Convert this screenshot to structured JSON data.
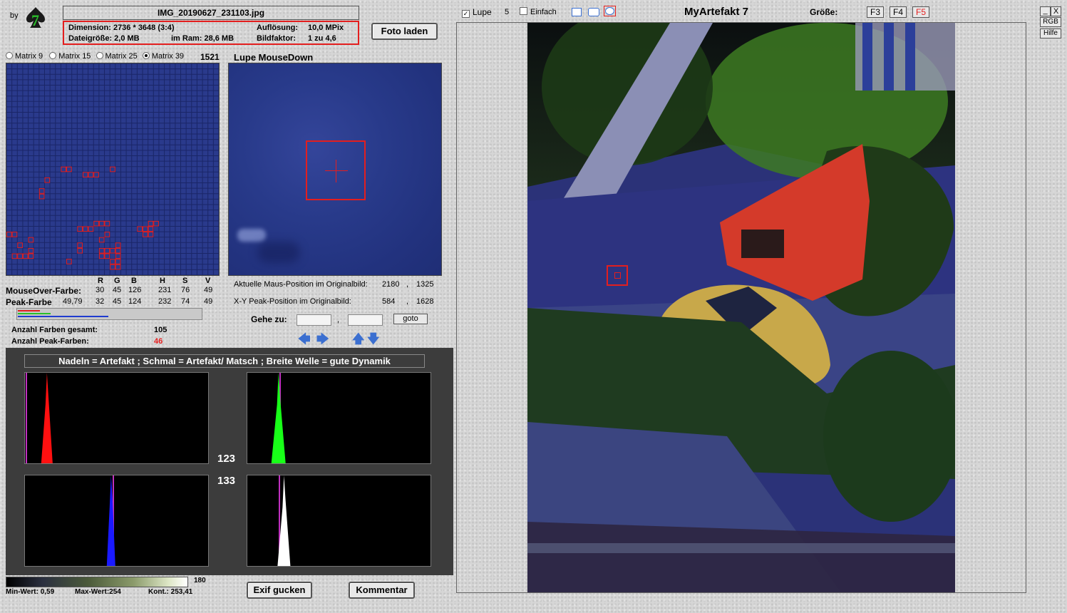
{
  "logo": {
    "by": "by",
    "seven": "7"
  },
  "file": {
    "name": "IMG_20190627_231103.jpg"
  },
  "info": {
    "dimension": "Dimension: 2736 * 3648 (3:4)",
    "aufloesung_label": "Auflösung:",
    "aufloesung_value": "10,0 MPix",
    "dateigroesse": "Dateigröße: 2,0 MB",
    "ram": "im Ram: 28,6 MB",
    "bildfaktor_label": "Bildfaktor:",
    "bildfaktor_value": "1 zu 4,6"
  },
  "buttons": {
    "foto_laden": "Foto laden",
    "goto": "goto",
    "exif": "Exif gucken",
    "kommentar": "Kommentar"
  },
  "matrix": {
    "options": [
      "Matrix 9",
      "Matrix 15",
      "Matrix 25",
      "Matrix 39"
    ],
    "selected": "Matrix 39",
    "count": "1521"
  },
  "lupe_title": "Lupe MouseDown",
  "color_table": {
    "headers": [
      "R",
      "G",
      "B",
      "H",
      "S",
      "V"
    ],
    "mouseover_label": "MouseOver-Farbe:",
    "mouseover_values": [
      "30",
      "45",
      "126",
      "231",
      "76",
      "49"
    ],
    "peak_label": "Peak-Farbe",
    "peak_extra": "49,79",
    "peak_values": [
      "32",
      "45",
      "124",
      "232",
      "74",
      "49"
    ]
  },
  "positions": {
    "maus_label": "Aktuelle Maus-Position  im Originalbild:",
    "maus_x": "2180",
    "maus_y": "1325",
    "peak_label": "X-Y Peak-Position  im Originalbild:",
    "peak_x": "584",
    "peak_y": "1628",
    "sep": ",",
    "gehe_zu": "Gehe zu:"
  },
  "counts": {
    "farben_label": "Anzahl Farben gesamt:",
    "farben_value": "105",
    "peak_label": "Anzahl Peak-Farben:",
    "peak_value": "46"
  },
  "histogram": {
    "caption": "Nadeln = Artefakt ; Schmal = Artefakt/ Matsch  ;  Breite Welle = gute Dynamik",
    "num1": "123",
    "num2": "133",
    "peaks": {
      "red": 0.12,
      "green": 0.17,
      "blue": 0.47,
      "white": 0.2
    }
  },
  "gradient": {
    "max": "180",
    "min_label": "Min-Wert: 0,59",
    "max_label": "Max-Wert:254",
    "kont_label": "Kont.: 253,41"
  },
  "topbar": {
    "lupe_label": "Lupe",
    "lupe_checked": true,
    "lupe_num": "5",
    "einfach_label": "Einfach",
    "einfach_checked": false,
    "app_title": "MyArtefakt 7",
    "groesse": "Größe:",
    "f_buttons": [
      "F3",
      "F4",
      "F5"
    ]
  },
  "window": {
    "min": "_",
    "close": "X",
    "rgb": "RGB",
    "hilfe": "Hilfe"
  },
  "colors": {
    "red": "#e41e1e",
    "matrix_blue": "#2a3a8c",
    "accent_blue": "#3b6fd0"
  }
}
